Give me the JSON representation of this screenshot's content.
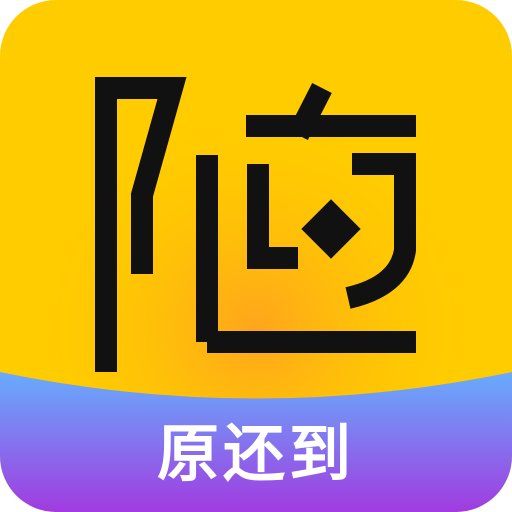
{
  "app_icon": {
    "glyph": "随",
    "label": "原还到",
    "colors": {
      "background_yellow": "#FFCC00",
      "glow_orange": "#FFA21E",
      "band_top_blue": "#62B6FF",
      "band_bottom_purple": "#A13BE0",
      "glyph_black": "#111111",
      "label_white": "#FFFFFF"
    }
  }
}
